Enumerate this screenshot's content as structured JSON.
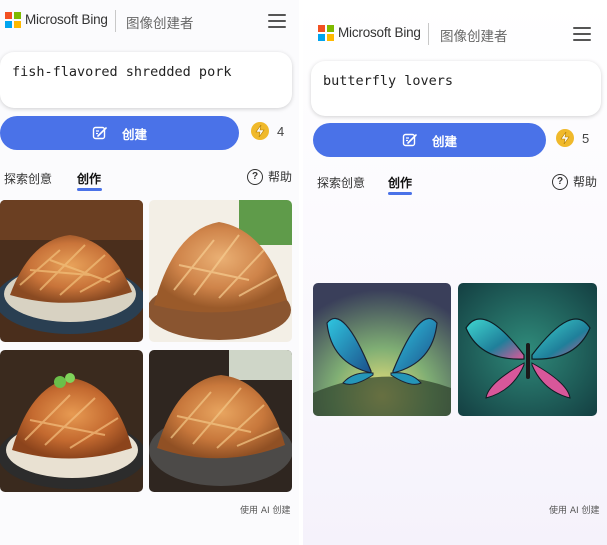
{
  "left": {
    "header": {
      "brand": "Microsoft Bing",
      "app_title": "图像创建者"
    },
    "prompt": {
      "value": "fish-flavored shredded pork"
    },
    "create_button": {
      "label": "创建"
    },
    "boosts": {
      "count": "4"
    },
    "tabs": [
      {
        "label": "探索创意",
        "active": false
      },
      {
        "label": "创作",
        "active": true
      }
    ],
    "help": {
      "label": "帮助"
    },
    "images": [
      "shredded pork dish 1",
      "shredded pork dish 2",
      "shredded pork dish 3",
      "shredded pork dish 4"
    ],
    "footer": "使用 AI 创建"
  },
  "right": {
    "header": {
      "brand": "Microsoft Bing",
      "app_title": "图像创建者"
    },
    "prompt": {
      "value": "butterfly lovers"
    },
    "create_button": {
      "label": "创建"
    },
    "boosts": {
      "count": "5"
    },
    "tabs": [
      {
        "label": "探索创意",
        "active": false
      },
      {
        "label": "创作",
        "active": true
      }
    ],
    "help": {
      "label": "帮助"
    },
    "images": [
      "butterflies image 1",
      "butterflies image 2"
    ],
    "footer": "使用 AI 创建"
  },
  "colors": {
    "accent": "#4a72e8",
    "boost": "#f0b92b"
  },
  "icons": [
    "microsoft-logo-icon",
    "hamburger-menu-icon",
    "create-wand-icon",
    "lightning-boost-icon",
    "help-icon"
  ]
}
